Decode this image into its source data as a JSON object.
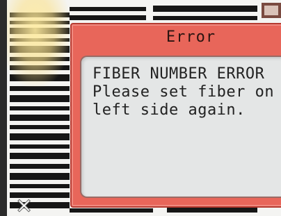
{
  "dialog": {
    "title": "Error",
    "message_lines": [
      "FIBER NUMBER ERROR",
      "Please set fiber on",
      "left side again."
    ]
  },
  "icons": {
    "close": "close-icon",
    "top_right": "status-icon"
  },
  "colors": {
    "dialog_frame": "#e8665a",
    "dialog_border": "#b53a30",
    "message_panel": "#e4e6e6",
    "text": "#222222"
  }
}
